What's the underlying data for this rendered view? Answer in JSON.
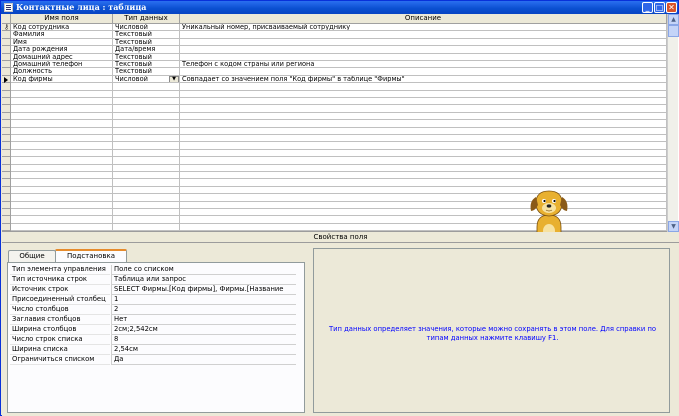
{
  "window": {
    "title": "Контактные лица : таблица",
    "minimize_glyph": "_",
    "maximize_glyph": "□",
    "close_glyph": "✕"
  },
  "grid": {
    "columns": [
      "Имя поля",
      "Тип данных",
      "Описание"
    ],
    "rows": [
      {
        "name": "Код сотрудника",
        "type": "Числовой",
        "desc": "Уникальный номер, присваиваемый сотруднику",
        "key": true
      },
      {
        "name": "Фамилия",
        "type": "Текстовый",
        "desc": ""
      },
      {
        "name": "Имя",
        "type": "Текстовый",
        "desc": ""
      },
      {
        "name": "Дата рождения",
        "type": "Дата/время",
        "desc": ""
      },
      {
        "name": "Домашний адрес",
        "type": "Текстовый",
        "desc": ""
      },
      {
        "name": "Домашний телефон",
        "type": "Текстовый",
        "desc": "Телефон с кодом страны или региона"
      },
      {
        "name": "Должность",
        "type": "Текстовый",
        "desc": ""
      },
      {
        "name": "Код фирмы",
        "type": "Числовой",
        "desc": "Совпадает со значением поля \"Код фирмы\" в таблице \"Фирмы\"",
        "current": true
      }
    ],
    "key_icon": "key-icon",
    "current_row_icon": "current-row-arrow-icon",
    "dropdown_glyph": "▼",
    "scroll_up_glyph": "▲",
    "scroll_down_glyph": "▼"
  },
  "properties": {
    "title": "Свойства поля",
    "tabs": [
      "Общие",
      "Подстановка"
    ],
    "active_tab": 1,
    "rows": [
      {
        "label": "Тип элемента управления",
        "value": "Поле со списком"
      },
      {
        "label": "Тип источника строк",
        "value": "Таблица или запрос"
      },
      {
        "label": "Источник строк",
        "value": "SELECT Фирмы.[Код фирмы], Фирмы.[Название"
      },
      {
        "label": "Присоединенный столбец",
        "value": "1"
      },
      {
        "label": "Число столбцов",
        "value": "2"
      },
      {
        "label": "Заглавия столбцов",
        "value": "Нет"
      },
      {
        "label": "Ширина столбцов",
        "value": "2см;2,542см"
      },
      {
        "label": "Число строк списка",
        "value": "8"
      },
      {
        "label": "Ширина списка",
        "value": "2,54см"
      },
      {
        "label": "Ограничиться списком",
        "value": "Да"
      }
    ],
    "help_text": "Тип данных определяет значения, которые можно сохранять в этом поле.  Для справки по типам данных нажмите клавишу F1."
  },
  "assistant": {
    "icon": "office-assistant-dog-icon"
  },
  "colors": {
    "titlebar": "#0a4fd0",
    "help_text": "#0000ff",
    "tab_accent": "#e68b2c"
  }
}
